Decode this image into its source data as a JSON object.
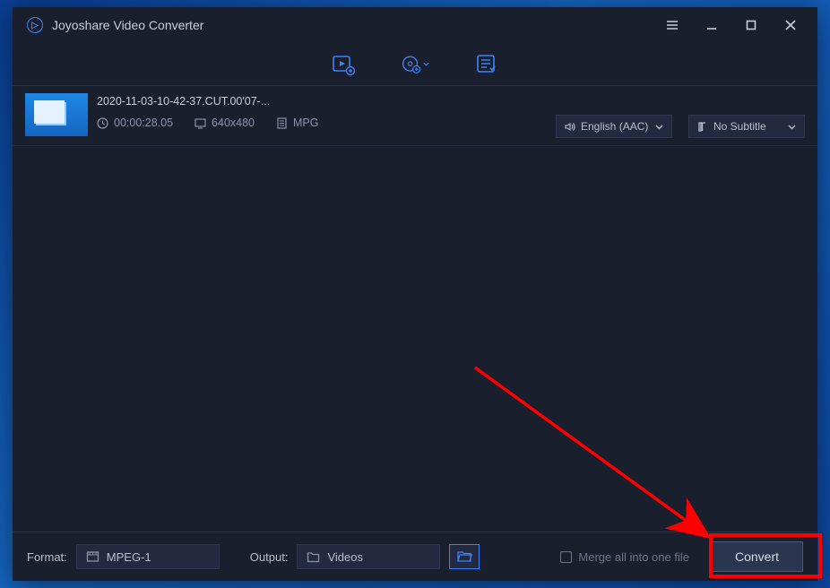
{
  "app": {
    "title": "Joyoshare Video Converter"
  },
  "file": {
    "name": "2020-11-03-10-42-37.CUT.00'07-...",
    "duration": "00:00:28.05",
    "resolution": "640x480",
    "container": "MPG",
    "audio_track": "English (AAC)",
    "subtitle": "No Subtitle"
  },
  "bottom": {
    "format_label": "Format:",
    "format_value": "MPEG-1",
    "output_label": "Output:",
    "output_value": "Videos",
    "merge_label": "Merge all into one file",
    "convert_label": "Convert"
  }
}
